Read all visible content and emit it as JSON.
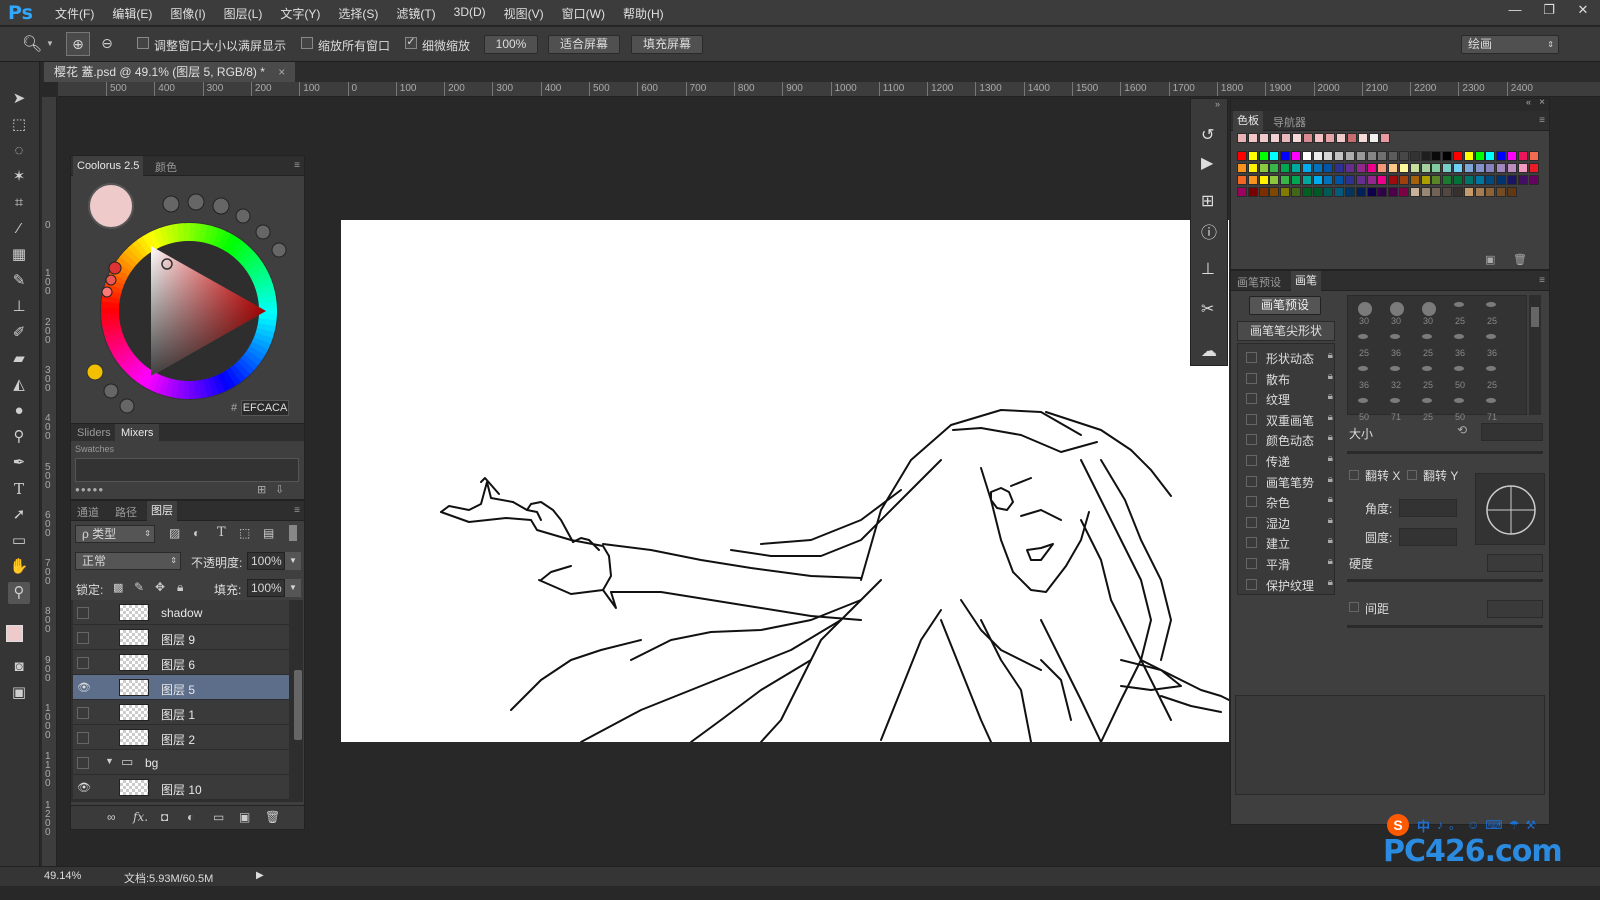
{
  "app": {
    "logo": "Ps"
  },
  "menu": [
    "文件(F)",
    "编辑(E)",
    "图像(I)",
    "图层(L)",
    "文字(Y)",
    "选择(S)",
    "滤镜(T)",
    "3D(D)",
    "视图(V)",
    "窗口(W)",
    "帮助(H)"
  ],
  "window_buttons": [
    "—",
    "❐",
    "✕"
  ],
  "options": {
    "resize_windows": "调整窗口大小以满屏显示",
    "zoom_all": "缩放所有窗口",
    "scrubby_zoom": "细微缩放",
    "zoom_value": "100%",
    "fit_screen": "适合屏幕",
    "fill_screen": "填充屏幕",
    "workspace": "绘画"
  },
  "document_tab": {
    "title": "樱花 蓋.psd @ 49.1% (图层 5, RGB/8) *",
    "close": "×"
  },
  "ruler_h": [
    "500",
    "400",
    "300",
    "200",
    "100",
    "0",
    "100",
    "200",
    "300",
    "400",
    "500",
    "600",
    "700",
    "800",
    "900",
    "1000",
    "1100",
    "1200",
    "1300",
    "1400",
    "1500",
    "1600",
    "1700",
    "1800",
    "1900",
    "2000",
    "2100",
    "2200",
    "2300",
    "2400"
  ],
  "ruler_v": [
    "0",
    "1 0 0",
    "2 0 0",
    "3 0 0",
    "4 0 0",
    "5 0 0",
    "6 0 0",
    "7 0 0",
    "8 0 0",
    "9 0 0",
    "1 0 0 0",
    "1 1 0 0",
    "1 2 0 0"
  ],
  "coolorus": {
    "tab1": "Coolorus 2.5",
    "tab2": "颜色",
    "hex": "EFCACA",
    "fg_color": "#EFCACA",
    "sliders_tab": "Sliders",
    "mixers_tab": "Mixers",
    "swatches_label": "Swatches"
  },
  "layers_panel": {
    "tabs": [
      "通道",
      "路径",
      "图层"
    ],
    "filter_kind": "ρ 类型",
    "blend_mode": "正常",
    "opacity_label": "不透明度:",
    "opacity_value": "100%",
    "lock_label": "锁定:",
    "fill_label": "填充:",
    "fill_value": "100%",
    "layers": [
      {
        "name": "shadow",
        "visible": false,
        "selected": false
      },
      {
        "name": "图层 9",
        "visible": false,
        "selected": false
      },
      {
        "name": "图层 6",
        "visible": false,
        "selected": false
      },
      {
        "name": "图层 5",
        "visible": true,
        "selected": true
      },
      {
        "name": "图层 1",
        "visible": false,
        "selected": false
      },
      {
        "name": "图层 2",
        "visible": false,
        "selected": false
      },
      {
        "name": "bg",
        "visible": false,
        "selected": false,
        "group": true
      },
      {
        "name": "图层 10",
        "visible": true,
        "selected": false
      }
    ],
    "footer_icons": [
      "link-icon",
      "fx-icon",
      "mask-icon",
      "adjustment-icon",
      "folder-icon",
      "new-layer-icon",
      "trash-icon"
    ],
    "fx_label": "fx."
  },
  "swatches_panel": {
    "tabs": [
      "色板",
      "导航器"
    ],
    "recent": [
      "#e8b4b8",
      "#f2c6c8",
      "#efcaca",
      "#f0d0d0",
      "#e9b8ba",
      "#f5d8d8",
      "#d88a90",
      "#f4c0c4",
      "#e6a2a6",
      "#f1caca",
      "#c96c70",
      "#f6dada",
      "#f0f0f0",
      "#e89aa0"
    ],
    "rows": [
      [
        "#ff0000",
        "#ffff00",
        "#00ff00",
        "#00ffff",
        "#0000ff",
        "#ff00ff",
        "#ffffff",
        "#ebebeb",
        "#d6d6d6",
        "#c2c2c2",
        "#adadad",
        "#999999",
        "#858585",
        "#707070",
        "#5c5c5c",
        "#474747",
        "#333333",
        "#1f1f1f",
        "#0a0a0a",
        "#000000",
        "#ff0000",
        "#ffff00",
        "#00ff00",
        "#00ffff",
        "#0000ff",
        "#ff00ff",
        "#ed145b",
        "#f26c4f"
      ],
      [
        "#f7941d",
        "#fff200",
        "#8dc63f",
        "#39b54a",
        "#00a651",
        "#00a99d",
        "#00aeef",
        "#0072bc",
        "#0054a6",
        "#2e3192",
        "#662d91",
        "#92278f",
        "#ec008c",
        "#f69679",
        "#fdc689",
        "#fff799",
        "#c4df9b",
        "#a3d39c",
        "#82ca9d",
        "#7accc8",
        "#6dcff6",
        "#7da7d9",
        "#8393ca",
        "#8781bd",
        "#a187be",
        "#bd8cbf",
        "#f49ac1",
        "#ed1c24"
      ],
      [
        "#f26522",
        "#f7941d",
        "#fff200",
        "#8dc63f",
        "#39b54a",
        "#00a651",
        "#00a99d",
        "#00aeef",
        "#0072bc",
        "#0054a6",
        "#2e3192",
        "#662d91",
        "#92278f",
        "#ec008c",
        "#9e0b0f",
        "#a0410d",
        "#a36209",
        "#aba000",
        "#598527",
        "#1a7b30",
        "#007236",
        "#00746b",
        "#0076a3",
        "#004a80",
        "#003471",
        "#1b1464",
        "#440e62",
        "#630460"
      ],
      [
        "#9e005d",
        "#790000",
        "#7b2e00",
        "#7d4900",
        "#827b00",
        "#406618",
        "#005e20",
        "#005826",
        "#005952",
        "#005b7f",
        "#003663",
        "#002157",
        "#0d004c",
        "#32004b",
        "#4b0049",
        "#7b0046",
        "#c7b299",
        "#998675",
        "#736357",
        "#534741",
        "#37302d",
        "#c69c6d",
        "#a67c52",
        "#8c6239",
        "#754c24",
        "#603913"
      ]
    ]
  },
  "brush_panel": {
    "tabs": [
      "画笔预设",
      "画笔"
    ],
    "preset_button": "画笔预设",
    "tip_shape": "画笔笔尖形状",
    "options": [
      "形状动态",
      "散布",
      "纹理",
      "双重画笔",
      "颜色动态",
      "传递",
      "画笔笔势",
      "杂色",
      "湿边",
      "建立",
      "平滑",
      "保护纹理"
    ],
    "tip_sizes": [
      "30",
      "30",
      "30",
      "25",
      "25",
      "25",
      "36",
      "25",
      "36",
      "36",
      "36",
      "32",
      "25",
      "50",
      "25",
      "50",
      "71",
      "25",
      "50",
      "71"
    ],
    "size_label": "大小",
    "flip_x": "翻转 X",
    "flip_y": "翻转 Y",
    "angle_label": "角度:",
    "roundness_label": "圆度:",
    "hardness_label": "硬度",
    "spacing_label": "间距"
  },
  "status": {
    "zoom": "49.14%",
    "doc": "文档:5.93M/60.5M"
  },
  "watermark": {
    "site": "PC426.com",
    "ime": "中"
  }
}
